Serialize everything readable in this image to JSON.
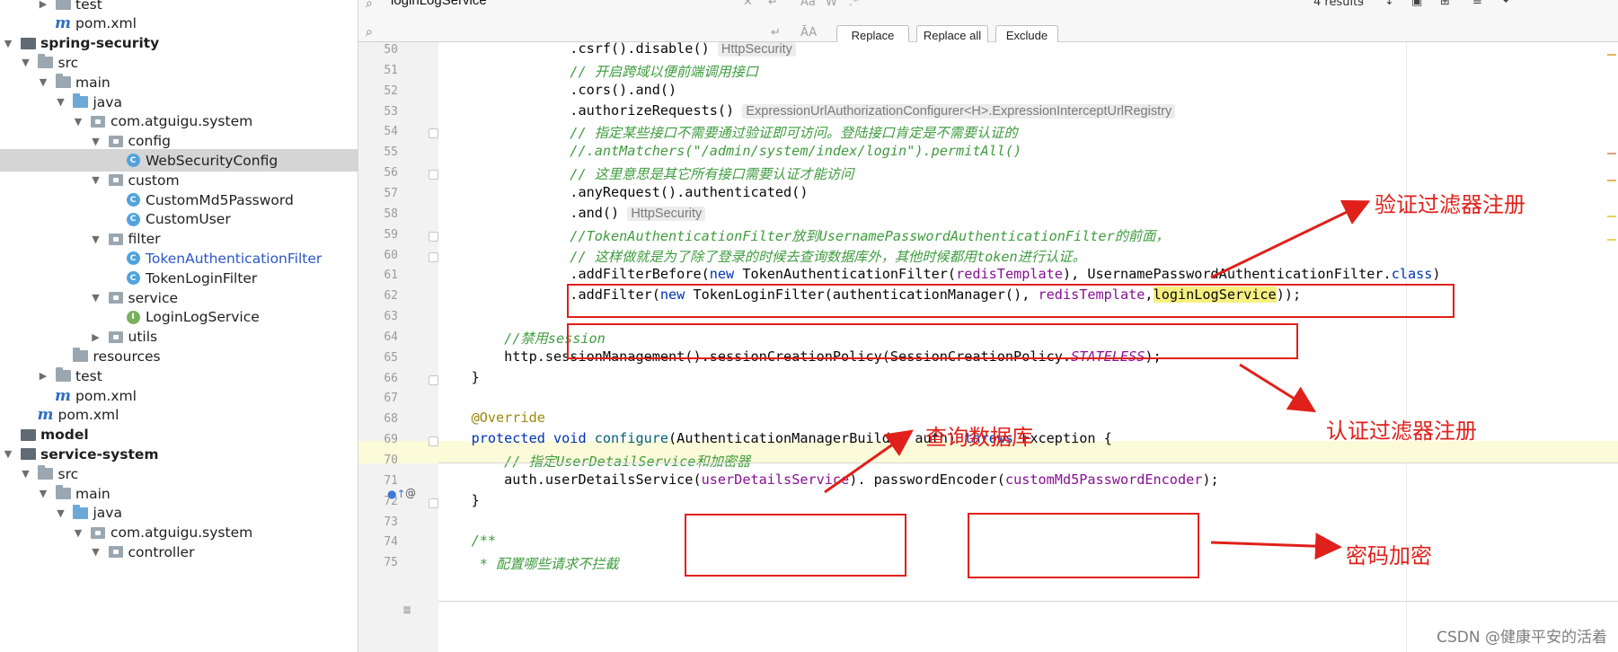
{
  "project_tree": [
    {
      "label": "test",
      "depth": 2,
      "arrow": "right",
      "icon": "folder",
      "style": ""
    },
    {
      "label": "pom.xml",
      "depth": 2,
      "arrow": "",
      "icon": "maven",
      "style": ""
    },
    {
      "label": "spring-security",
      "depth": 0,
      "arrow": "down",
      "icon": "module",
      "style": "bold"
    },
    {
      "label": "src",
      "depth": 1,
      "arrow": "down",
      "icon": "folder",
      "style": ""
    },
    {
      "label": "main",
      "depth": 2,
      "arrow": "down",
      "icon": "folder",
      "style": ""
    },
    {
      "label": "java",
      "depth": 3,
      "arrow": "down",
      "icon": "folder-blue",
      "style": ""
    },
    {
      "label": "com.atguigu.system",
      "depth": 4,
      "arrow": "down",
      "icon": "package",
      "style": ""
    },
    {
      "label": "config",
      "depth": 5,
      "arrow": "down",
      "icon": "package",
      "style": ""
    },
    {
      "label": "WebSecurityConfig",
      "depth": 6,
      "arrow": "",
      "icon": "class",
      "style": "sel"
    },
    {
      "label": "custom",
      "depth": 5,
      "arrow": "down",
      "icon": "package",
      "style": ""
    },
    {
      "label": "CustomMd5Password",
      "depth": 6,
      "arrow": "",
      "icon": "class",
      "style": ""
    },
    {
      "label": "CustomUser",
      "depth": 6,
      "arrow": "",
      "icon": "class",
      "style": ""
    },
    {
      "label": "filter",
      "depth": 5,
      "arrow": "down",
      "icon": "package",
      "style": ""
    },
    {
      "label": "TokenAuthenticationFilter",
      "depth": 6,
      "arrow": "",
      "icon": "class",
      "style": "blue"
    },
    {
      "label": "TokenLoginFilter",
      "depth": 6,
      "arrow": "",
      "icon": "class",
      "style": ""
    },
    {
      "label": "service",
      "depth": 5,
      "arrow": "down",
      "icon": "package",
      "style": ""
    },
    {
      "label": "LoginLogService",
      "depth": 6,
      "arrow": "",
      "icon": "interface",
      "style": ""
    },
    {
      "label": "utils",
      "depth": 5,
      "arrow": "right",
      "icon": "package",
      "style": ""
    },
    {
      "label": "resources",
      "depth": 3,
      "arrow": "",
      "icon": "folder-res",
      "style": ""
    },
    {
      "label": "test",
      "depth": 2,
      "arrow": "right",
      "icon": "folder",
      "style": ""
    },
    {
      "label": "pom.xml",
      "depth": 2,
      "arrow": "",
      "icon": "maven",
      "style": ""
    },
    {
      "label": "pom.xml",
      "depth": 1,
      "arrow": "",
      "icon": "maven",
      "style": ""
    },
    {
      "label": "model",
      "depth": 0,
      "arrow": "",
      "icon": "module",
      "style": "bold"
    },
    {
      "label": "service-system",
      "depth": 0,
      "arrow": "down",
      "icon": "module",
      "style": "bold"
    },
    {
      "label": "src",
      "depth": 1,
      "arrow": "down",
      "icon": "folder",
      "style": ""
    },
    {
      "label": "main",
      "depth": 2,
      "arrow": "down",
      "icon": "folder",
      "style": ""
    },
    {
      "label": "java",
      "depth": 3,
      "arrow": "down",
      "icon": "folder-blue",
      "style": ""
    },
    {
      "label": "com.atguigu.system",
      "depth": 4,
      "arrow": "down",
      "icon": "package",
      "style": ""
    },
    {
      "label": "controller",
      "depth": 5,
      "arrow": "down",
      "icon": "package",
      "style": ""
    }
  ],
  "search": {
    "query": "loginLogService",
    "results": "4 results",
    "replace_label": "Replace",
    "replace_all_label": "Replace all",
    "exclude_label": "Exclude"
  },
  "code_lines": [
    {
      "num": "50",
      "segs": [
        [
          "",
          "                .csrf().disable() "
        ],
        [
          "hint",
          "HttpSecurity"
        ]
      ]
    },
    {
      "num": "51",
      "segs": [
        [
          "cm",
          "                // 开启跨域以便前端调用接口"
        ]
      ]
    },
    {
      "num": "52",
      "segs": [
        [
          "",
          "                .cors().and()"
        ]
      ]
    },
    {
      "num": "53",
      "segs": [
        [
          "",
          "                .authorizeRequests() "
        ],
        [
          "hint",
          "ExpressionUrlAuthorizationConfigurer<H>.ExpressionInterceptUrlRegistry"
        ]
      ]
    },
    {
      "num": "54",
      "segs": [
        [
          "cm",
          "                // 指定某些接口不需要通过验证即可访问。登陆接口肯定是不需要认证的"
        ]
      ]
    },
    {
      "num": "55",
      "segs": [
        [
          "cm",
          "                //.antMatchers(\"/admin/system/index/login\").permitAll()"
        ]
      ]
    },
    {
      "num": "56",
      "segs": [
        [
          "cm",
          "                // 这里意思是其它所有接口需要认证才能访问"
        ]
      ]
    },
    {
      "num": "57",
      "segs": [
        [
          "",
          "                .anyRequest().authenticated()"
        ]
      ]
    },
    {
      "num": "58",
      "segs": [
        [
          "",
          "                .and() "
        ],
        [
          "hint",
          "HttpSecurity"
        ]
      ]
    },
    {
      "num": "59",
      "segs": [
        [
          "cm",
          "                //TokenAuthenticationFilter放到UsernamePasswordAuthenticationFilter的前面，"
        ]
      ]
    },
    {
      "num": "60",
      "segs": [
        [
          "cm",
          "                // 这样做就是为了除了登录的时候去查询数据库外，其他时候都用token进行认证。"
        ]
      ]
    },
    {
      "num": "61",
      "segs": [
        [
          "",
          "                .addFilterBefore("
        ],
        [
          "kw",
          "new"
        ],
        [
          "",
          " TokenAuthenticationFilter("
        ],
        [
          "pu",
          "redisTemplate"
        ],
        [
          "",
          "), UsernamePasswordAuthenticationFilter."
        ],
        [
          "kw",
          "class"
        ],
        [
          "",
          ")"
        ]
      ]
    },
    {
      "num": "62",
      "segs": [
        [
          "",
          "                .addFilter("
        ],
        [
          "kw",
          "new"
        ],
        [
          "",
          " TokenLoginFilter(authenticationManager(), "
        ],
        [
          "pu",
          "redisTemplate"
        ],
        [
          "",
          ","
        ],
        [
          "hl",
          "loginLogService"
        ],
        [
          "",
          "));"
        ]
      ]
    },
    {
      "num": "63",
      "segs": []
    },
    {
      "num": "64",
      "segs": [
        [
          "cm",
          "        //禁用session"
        ]
      ]
    },
    {
      "num": "65",
      "segs": [
        [
          "",
          "        http.sessionManagement().sessionCreationPolicy(SessionCreationPolicy."
        ],
        [
          "sf",
          "STATELESS"
        ],
        [
          "",
          ");"
        ]
      ]
    },
    {
      "num": "66",
      "segs": [
        [
          "",
          "    }"
        ]
      ]
    },
    {
      "num": "67",
      "segs": []
    },
    {
      "num": "68",
      "segs": [
        [
          "an",
          "    @Override"
        ]
      ]
    },
    {
      "num": "69",
      "segs": [
        [
          "kw",
          "    protected void "
        ],
        [
          "fn",
          "configure"
        ],
        [
          "",
          "(AuthenticationManagerBuilder auth) "
        ],
        [
          "kw",
          "throws"
        ],
        [
          "",
          " Exception {"
        ]
      ]
    },
    {
      "num": "70",
      "segs": [
        [
          "cm",
          "        // 指定UserDetailService和加密器"
        ]
      ]
    },
    {
      "num": "71",
      "segs": [
        [
          "",
          "        auth.userDetailsService("
        ],
        [
          "pu",
          "userDetailsService"
        ],
        [
          "",
          "). passwordEncoder("
        ],
        [
          "pu",
          "customMd5PasswordEncoder"
        ],
        [
          "",
          ");"
        ]
      ]
    },
    {
      "num": "72",
      "segs": [
        [
          "",
          "    }"
        ]
      ]
    },
    {
      "num": "73",
      "segs": []
    },
    {
      "num": "74",
      "segs": [
        [
          "cm",
          "    /**"
        ]
      ]
    },
    {
      "num": "75",
      "segs": [
        [
          "cm",
          "     * 配置哪些请求不拦截"
        ]
      ]
    }
  ],
  "annotations": {
    "verify_filter": "验证过滤器注册",
    "auth_filter": "认证过滤器注册",
    "query_db": "查询数据库",
    "password_encrypt": "密码加密"
  },
  "watermark": "CSDN @健康平安的活着",
  "colors": {
    "annotation": "#e0201a",
    "selection": "#d5d5d5",
    "comment": "#3f9c3f",
    "keyword": "#0033b3"
  }
}
